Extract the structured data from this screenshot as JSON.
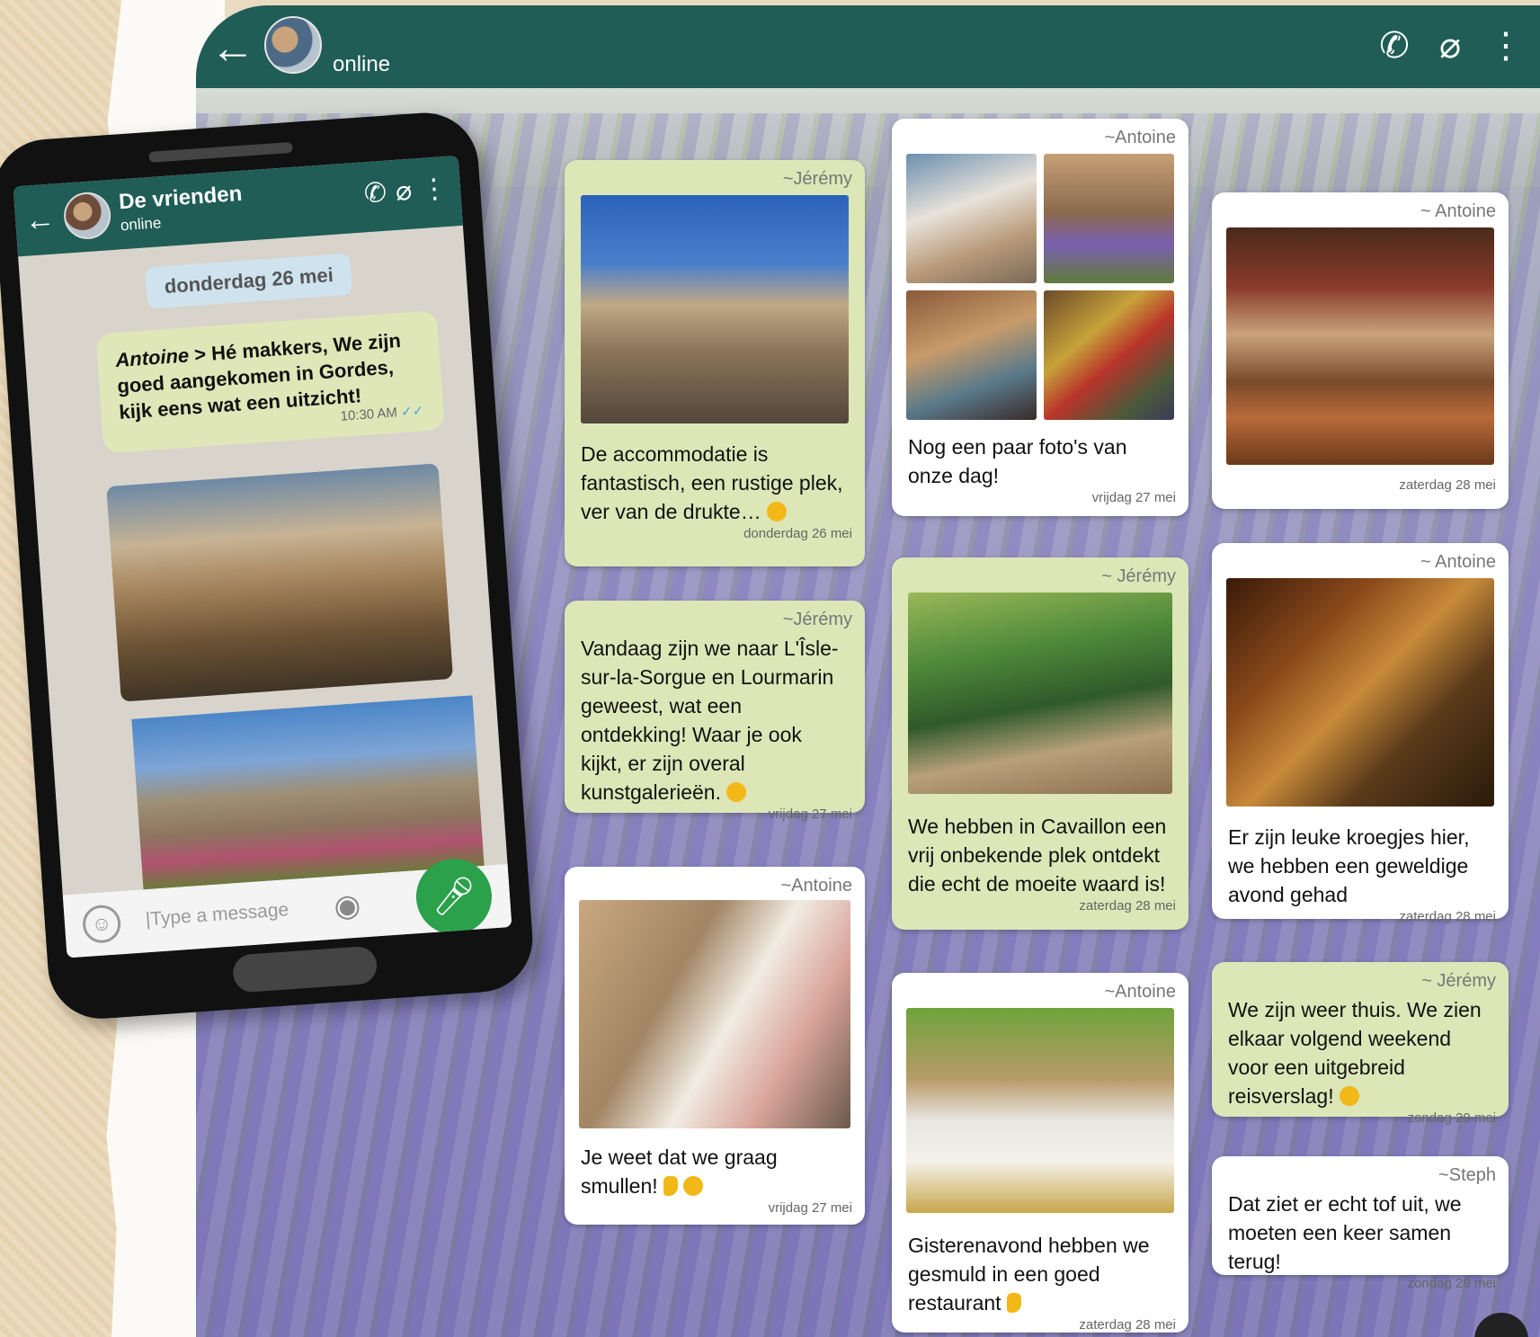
{
  "window": {
    "status": "online",
    "icons": [
      "phone-icon",
      "paperclip-icon",
      "more-icon"
    ]
  },
  "phone": {
    "chat_name": "De vrienden",
    "chat_status": "online",
    "date_chip": "donderdag 26 mei",
    "message": {
      "author": "Antoine",
      "separator": "> ",
      "text": "Hé makkers, We zijn goed aangekomen in Gordes, kijk eens wat een uitzicht!",
      "time": "10:30 AM",
      "ticks": "✓✓"
    },
    "input_placeholder": "|Type a message"
  },
  "bubbles": [
    {
      "author": "~Jérémy",
      "text": "De accommodatie is fantastisch, een rustige plek, ver van de drukte…",
      "date": "donderdag 26 mei"
    },
    {
      "author": "~Jérémy",
      "text": "Vandaag zijn we naar L'Îsle-sur-la-Sorgue en Lourmarin geweest, wat een ontdekking! Waar je ook kijkt, er zijn overal kunstgalerieën.",
      "date": "vrijdag 27 mei"
    },
    {
      "author": "~Antoine",
      "text": "Je weet dat we graag smullen!",
      "date": "vrijdag 27 mei"
    },
    {
      "author": "~Antoine",
      "text": "Nog een paar foto's van onze dag!",
      "date": "vrijdag 27 mei"
    },
    {
      "author": "~ Jérémy",
      "text": "We hebben in Cavaillon een vrij onbekende plek ontdekt die echt de moeite waard is!",
      "date": "zaterdag 28 mei"
    },
    {
      "author": "~Antoine",
      "text": "Gisterenavond hebben we gesmuld in een goed restaurant",
      "date": "zaterdag 28 mei"
    },
    {
      "author": "~ Antoine",
      "text": "",
      "date": "zaterdag 28 mei"
    },
    {
      "author": "~ Antoine",
      "text": "Er zijn leuke kroegjes hier, we hebben een geweldige avond gehad",
      "date": "zaterdag 28 mei"
    },
    {
      "author": "~ Jérémy",
      "text": "We zijn weer thuis. We zien elkaar volgend weekend voor een uitgebreid reisverslag!",
      "date": "zondag 29 mei"
    },
    {
      "author": "~Steph",
      "text": "Dat ziet er echt tof uit, we moeten een keer samen terug!",
      "date": "zondag 29 mei"
    }
  ],
  "colors": {
    "header": "#1f5d56",
    "bubble_green": "#dde6b7",
    "mic": "#2aa14a"
  }
}
